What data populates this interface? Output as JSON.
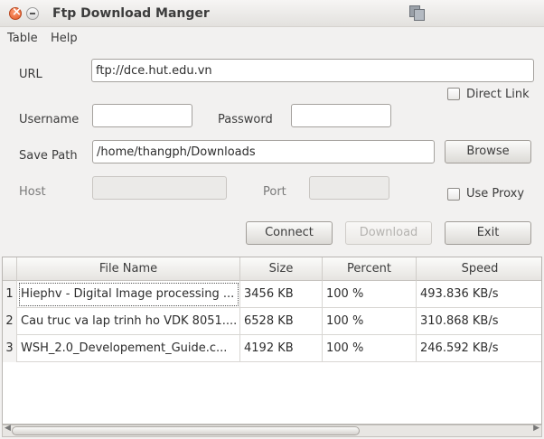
{
  "window": {
    "title": "Ftp Download Manger"
  },
  "menu": [
    "Table",
    "Help"
  ],
  "form": {
    "url_label": "URL",
    "url_value": "ftp://dce.hut.edu.vn",
    "direct_link_label": "Direct Link",
    "username_label": "Username",
    "username_value": "",
    "password_label": "Password",
    "password_value": "",
    "save_path_label": "Save Path",
    "save_path_value": "/home/thangph/Downloads",
    "browse_label": "Browse",
    "host_label": "Host",
    "port_label": "Port",
    "use_proxy_label": "Use Proxy"
  },
  "buttons": {
    "connect": "Connect",
    "download": "Download",
    "exit": "Exit"
  },
  "table": {
    "columns": [
      "File Name",
      "Size",
      "Percent",
      "Speed"
    ],
    "rows": [
      {
        "index": "1",
        "file_name": "Hiephv - Digital Image processing ...",
        "size": "3456 KB",
        "percent": "100 %",
        "speed": "493.836 KB/s"
      },
      {
        "index": "2",
        "file_name": "Cau truc va lap trinh ho VDK 8051....",
        "size": "6528 KB",
        "percent": "100 %",
        "speed": "310.868 KB/s"
      },
      {
        "index": "3",
        "file_name": "WSH_2.0_Developement_Guide.c...",
        "size": "4192 KB",
        "percent": "100 %",
        "speed": "246.592 KB/s"
      }
    ]
  }
}
